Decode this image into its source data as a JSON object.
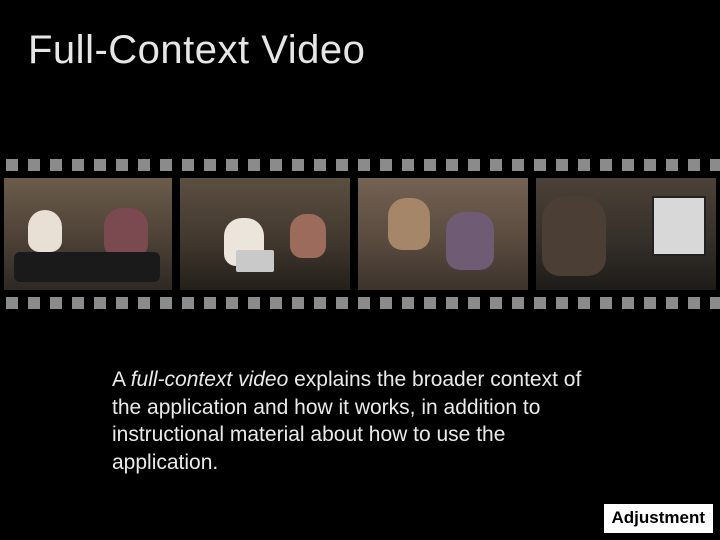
{
  "slide": {
    "title": "Full-Context Video",
    "body_prefix": "A ",
    "body_em": "full-context video",
    "body_rest": " explains the broader context of the application and how it works, in addition to instructional material about how to use the application.",
    "corner_label": "Adjustment"
  },
  "filmstrip": {
    "frames": [
      {
        "name": "frame-1",
        "alt": "two people seated on sofa"
      },
      {
        "name": "frame-2",
        "alt": "man with laptop, woman nearby"
      },
      {
        "name": "frame-3",
        "alt": "two women talking"
      },
      {
        "name": "frame-4",
        "alt": "woman looking at computer screen"
      }
    ]
  }
}
